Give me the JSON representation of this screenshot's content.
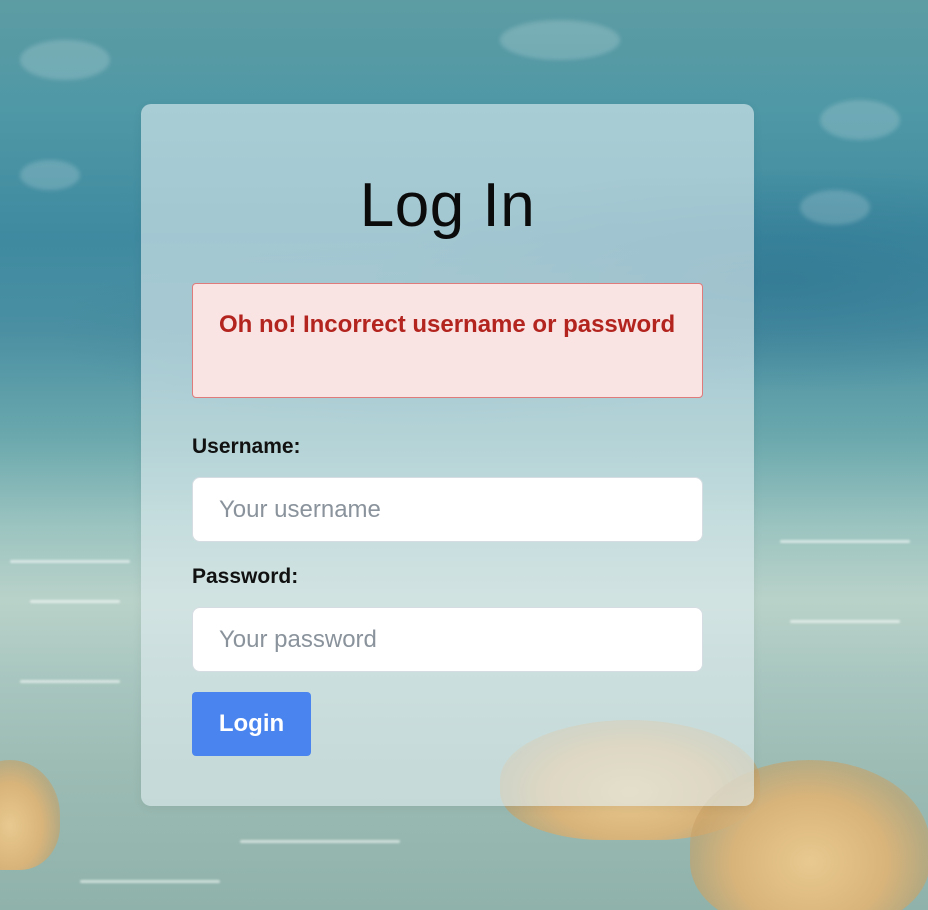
{
  "page": {
    "title": "Log In"
  },
  "alert": {
    "message": "Oh no! Incorrect username or password",
    "color": "#b3241f",
    "background": "#f9e3e3"
  },
  "form": {
    "username_label": "Username:",
    "username_placeholder": "Your username",
    "username_value": "",
    "password_label": "Password:",
    "password_placeholder": "Your password",
    "password_value": "",
    "submit_label": "Login",
    "submit_color": "#4a84ee"
  },
  "background": {
    "theme": "underwater-sea-floor"
  }
}
